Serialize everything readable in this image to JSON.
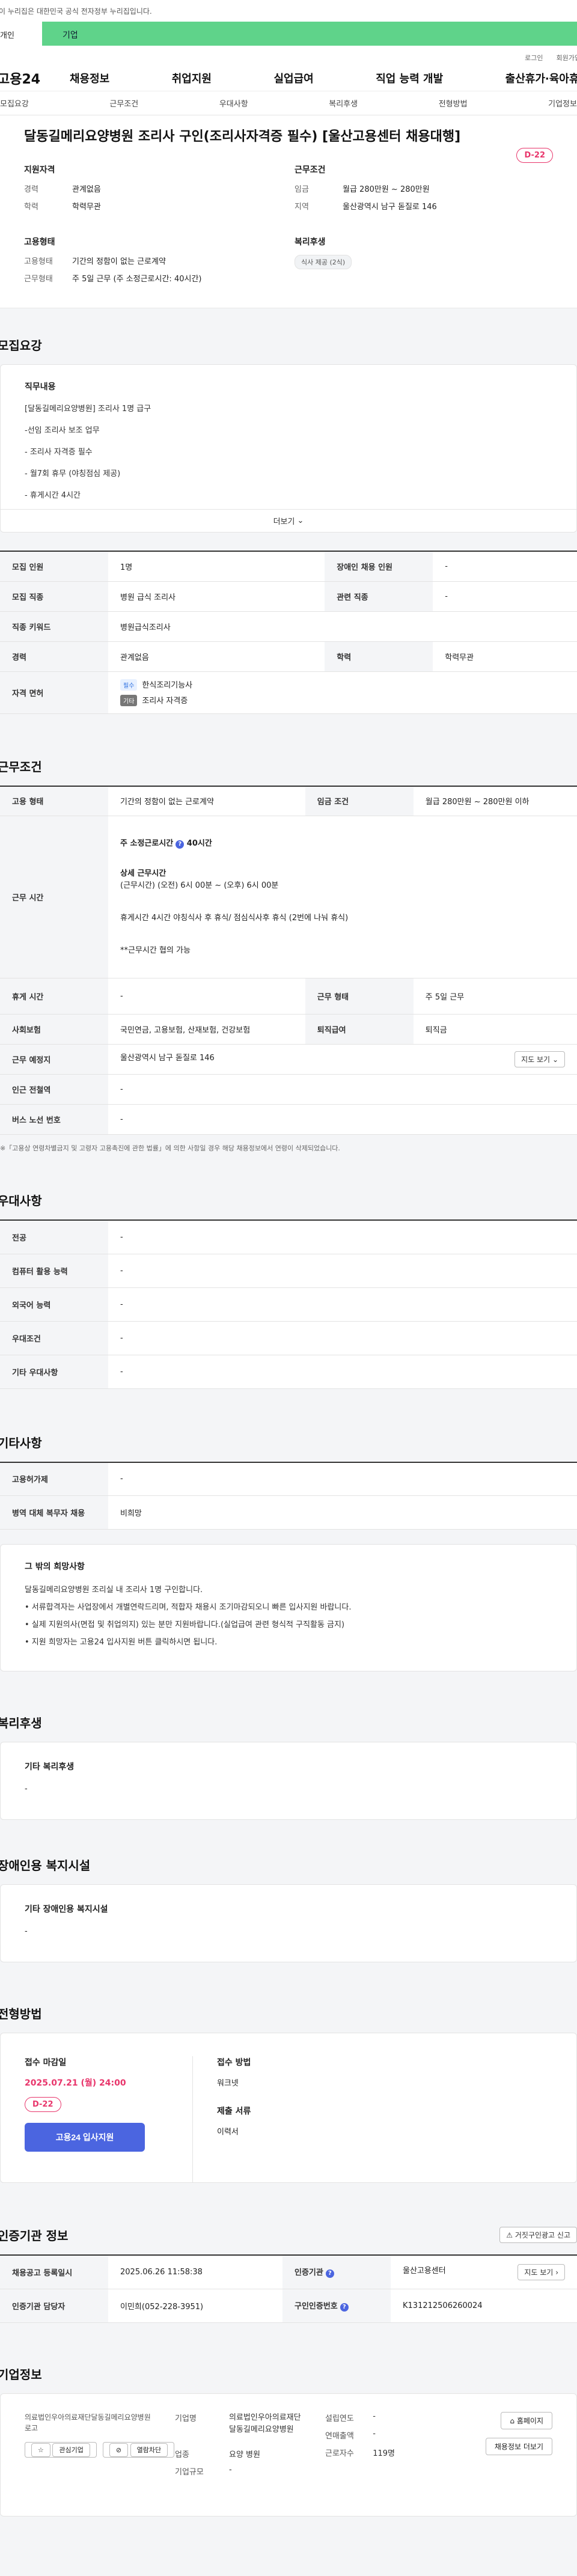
{
  "gov_banner": "이 누리집은 대한민국 공식 전자정부 누리집입니다.",
  "category": {
    "left": "개인",
    "right": "기업"
  },
  "util": [
    "로그인",
    "회원가입"
  ],
  "gnb": {
    "logo": "고용24",
    "menus": [
      "채용정보",
      "취업지원",
      "실업급여",
      "직업 능력 개발",
      "출산휴가·육아휴직"
    ]
  },
  "subnav": [
    "모집요강",
    "근무조건",
    "우대사항",
    "복리후생",
    "전형방법",
    "기업정보"
  ],
  "job": {
    "title": "달동길메리요양병원 조리사 구인(조리사자격증 필수) [울산고용센터 채용대행]",
    "dday": "D-22",
    "summary": {
      "qual_title": "지원자격",
      "qual": [
        [
          "경력",
          "관계없음"
        ],
        [
          "학력",
          "학력무관"
        ]
      ],
      "cond_title": "근무조건",
      "cond": [
        [
          "임금",
          "월급 280만원 ~ 280만원"
        ],
        [
          "지역",
          "울산광역시 남구 돋질로 146"
        ]
      ],
      "emp_title": "고용형태",
      "emp": [
        [
          "고용형태",
          "기간의 정함이 없는 근로계약"
        ],
        [
          "근무형태",
          "주 5일 근무 (주 소정근로시간: 40시간)"
        ]
      ],
      "welfare_title": "복리후생",
      "welfare_tag": "식사 제공 (2식)"
    }
  },
  "recruit": {
    "section": "모집요강",
    "detail_title": "직무내용",
    "lines": [
      "[달동길메리요양병원] 조리사 1명 급구",
      "-선임 조리사 보조 업무",
      "- 조리사 자격증 필수",
      "- 월7회 휴무 (야칭점심 제공)",
      "- 휴게시간 4시간"
    ],
    "more": "더보기",
    "rows": [
      [
        [
          "모집 인원",
          "1명"
        ],
        [
          "장애인 채용 인원",
          "-"
        ]
      ],
      [
        [
          "모집 직종",
          "병원 급식 조리사"
        ],
        [
          "관련 직종",
          "-"
        ]
      ],
      [
        [
          "직종 키워드",
          "병원급식조리사"
        ]
      ],
      [
        [
          "경력",
          "관계없음"
        ],
        [
          "학력",
          "학력무관"
        ]
      ]
    ],
    "license_label": "자격 면허",
    "license": [
      {
        "badge": "필수",
        "name": "한식조리기능사"
      },
      {
        "badge": "기타",
        "name": "조리사 자격증"
      }
    ]
  },
  "work": {
    "section": "근무조건",
    "type_label": "고용 형태",
    "type": "기간의 정함이 없는 근로계약",
    "wage_label": "임금 조건",
    "wage": "월급 280만원 ~ 280만원 이하",
    "time_label": "근무 시간",
    "hours": "주 소정근로시간",
    "hours_val": "40시간",
    "detail_title": "상세 근무시간",
    "detail_line": "(근무시간) (오전) 6시 00분 ~ (오후) 6시 00분",
    "rest_line": "휴게시간 4시간 야칭식사 후 휴식/ 점심식사후 휴식 (2번에 나눠 휴식)",
    "nego": "**근무시간 협의 가능",
    "rest_label": "휴게 시간",
    "rest": "-",
    "form_label": "근무 형태",
    "form": "주 5일 근무",
    "ins_label": "사회보험",
    "ins": "국민연금, 고용보험, 산재보험, 건강보험",
    "sev_label": "퇴직급여",
    "sev": "퇴직금",
    "place_label": "근무 예정지",
    "place": "울산광역시 남구 돋질로 146",
    "map_btn": "지도 보기",
    "station_label": "인근 전철역",
    "station": "-",
    "bus_label": "버스 노선 번호",
    "bus": "-",
    "note": "※「고용상 연령차별금지 및 고령자 고용촉진에 관한 법률」에 의한 사항일 경우 해당 채용정보에서 연령이 삭제되었습니다."
  },
  "pref": {
    "section": "우대사항",
    "rows": [
      [
        "전공",
        "-"
      ],
      [
        "컴퓨터 활용 능력",
        "-"
      ],
      [
        "외국어 능력",
        "-"
      ],
      [
        "우대조건",
        "-"
      ],
      [
        "기타 우대사항",
        "-"
      ]
    ]
  },
  "etc": {
    "section": "기타사항",
    "rows": [
      [
        "고용허가제",
        "-"
      ],
      [
        "병역 대체 복무자 채용",
        "비희망"
      ]
    ],
    "wish_title": "그 밖의 희망사항",
    "wish": [
      "달동길메리요양병원 조리실 내 조리사 1명 구인합니다.",
      "• 서류합격자는 사업장에서 개별연락드리며, 적합자 채용시 조기마감되오니 빠른 입사지원 바랍니다.",
      "• 실제 지원의사(면접 및 취업의지) 있는 분만 지원바랍니다.(실업급여 관련 형식적 구직활동 금지)",
      "• 지원 희망자는 고용24 입사지원 버튼 클릭하시면 됩니다."
    ]
  },
  "welfare": {
    "section": "복리후생",
    "title": "기타 복리후생",
    "value": "-"
  },
  "disab": {
    "section": "장애인용 복지시설",
    "title": "기타 장애인용 복지시설",
    "value": "-"
  },
  "apply": {
    "section": "전형방법",
    "deadline_title": "접수 마감일",
    "deadline": "2025.07.21 (월) 24:00",
    "dday": "D-22",
    "btn": "고용24 입사지원",
    "method_title": "접수 방법",
    "method": "워크넷",
    "docs_title": "제출 서류",
    "docs": "이력서"
  },
  "agency": {
    "section": "인증기관 정보",
    "report_btn": "거짓구인광고 신고",
    "reg_label": "채용공고 등록일시",
    "reg": "2025.06.26 11:58:38",
    "org_label": "인증기관",
    "org": "울산고용센터",
    "map_btn": "지도 보기",
    "manager_label": "인증기관 담당자",
    "manager": "이민희(052-228-3951)",
    "num_label": "구인인증번호",
    "num": "K131212506260024"
  },
  "company": {
    "section": "기업정보",
    "logo_alt": "의료법인우아의료재단달동길메리요양병원 로고",
    "fav_btn": "관심기업",
    "block_btn": "열람차단",
    "name_label": "기업명",
    "name": "의료법인우아의료재단달동길메리요양병원",
    "est_label": "설립연도",
    "est": "-",
    "sales_label": "연매출액",
    "sales": "-",
    "emp_label": "근로자수",
    "emp": "119명",
    "ind_label": "업종",
    "ind": "요양 병원",
    "size_label": "기업규모",
    "size": "-",
    "home_btn": "홈페이지",
    "list_btn": "채용정보 더보기"
  }
}
